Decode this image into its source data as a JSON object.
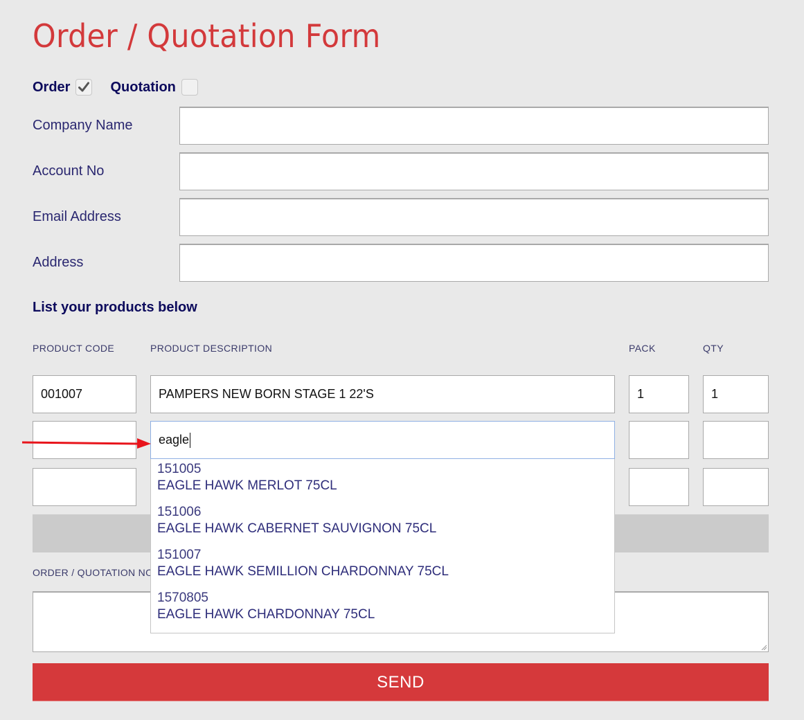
{
  "page": {
    "title": "Order / Quotation Form"
  },
  "type_selector": {
    "order_label": "Order",
    "order_checked": true,
    "quotation_label": "Quotation",
    "quotation_checked": false
  },
  "fields": [
    {
      "label": "Company Name",
      "value": ""
    },
    {
      "label": "Account No",
      "value": ""
    },
    {
      "label": "Email Address",
      "value": ""
    },
    {
      "label": "Address",
      "value": ""
    }
  ],
  "products": {
    "heading": "List your products below",
    "columns": {
      "code": "PRODUCT CODE",
      "description": "PRODUCT DESCRIPTION",
      "pack": "PACK",
      "qty": "QTY"
    },
    "rows": [
      {
        "code": "001007",
        "description": "PAMPERS NEW BORN STAGE 1 22'S",
        "pack": "1",
        "qty": "1"
      },
      {
        "code": "",
        "description": "eagle",
        "pack": "",
        "qty": ""
      },
      {
        "code": "",
        "description": "",
        "pack": "",
        "qty": ""
      }
    ],
    "autocomplete": [
      {
        "code": "151005",
        "description": "EAGLE HAWK MERLOT 75CL"
      },
      {
        "code": "151006",
        "description": "EAGLE HAWK CABERNET SAUVIGNON 75CL"
      },
      {
        "code": "151007",
        "description": "EAGLE HAWK SEMILLION CHARDONNAY 75CL"
      },
      {
        "code": "1570805",
        "description": "EAGLE HAWK CHARDONNAY 75CL"
      }
    ]
  },
  "notes": {
    "label": "ORDER / QUOTATION NOTES",
    "value": ""
  },
  "send_button": {
    "label": "SEND"
  },
  "colors": {
    "accent_red": "#d5393b",
    "heading_navy": "#0c0a5c",
    "background": "#e9e9e9",
    "annotation_arrow": "#e8141b"
  }
}
